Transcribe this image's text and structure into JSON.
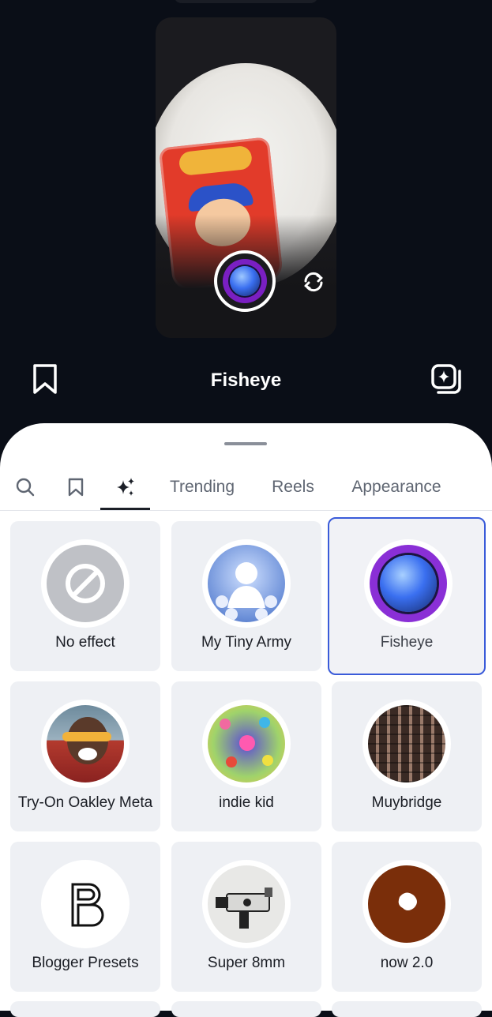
{
  "header": {
    "title": "Fisheye",
    "bookmark_icon": "bookmark-outline-icon",
    "gallery_icon": "gallery-sparkle-icon"
  },
  "camera": {
    "capture_icon": "fisheye-lens-icon",
    "flip_icon": "flip-camera-icon"
  },
  "tabs": [
    {
      "kind": "icon",
      "icon": "search-icon"
    },
    {
      "kind": "icon",
      "icon": "bookmark-icon"
    },
    {
      "kind": "icon",
      "icon": "sparkles-icon",
      "active": true
    },
    {
      "kind": "text",
      "label": "Trending"
    },
    {
      "kind": "text",
      "label": "Reels"
    },
    {
      "kind": "text",
      "label": "Appearance"
    }
  ],
  "effects": [
    {
      "label": "No effect",
      "icon": "no-effect-icon"
    },
    {
      "label": "My Tiny Army",
      "icon": "tiny-army-icon"
    },
    {
      "label": "Fisheye",
      "icon": "fisheye-icon",
      "selected": true
    },
    {
      "label": "Try-On Oakley Meta",
      "icon": "oakley-icon"
    },
    {
      "label": "indie kid",
      "icon": "indie-kid-icon"
    },
    {
      "label": "Muybridge",
      "icon": "muybridge-icon"
    },
    {
      "label": "Blogger Presets",
      "icon": "blogger-presets-icon"
    },
    {
      "label": "Super 8mm",
      "icon": "super-8mm-icon"
    },
    {
      "label": "now 2.0",
      "icon": "now-icon"
    }
  ],
  "colors": {
    "accent": "#3a5bd9",
    "background_dark": "#0a0e17",
    "tile": "#eef0f4"
  }
}
